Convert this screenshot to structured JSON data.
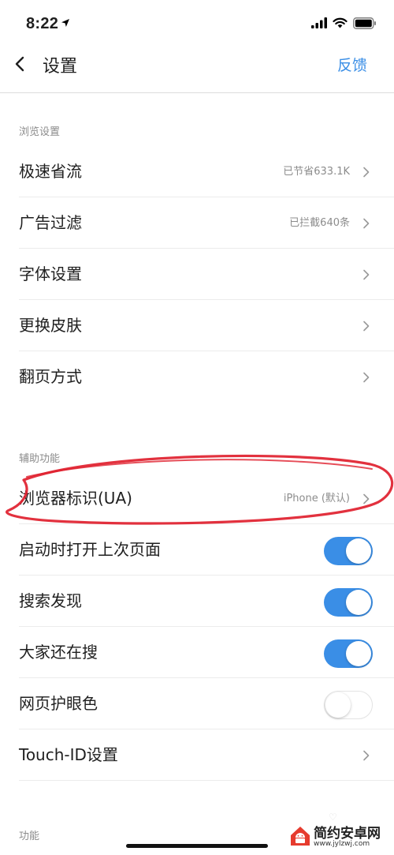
{
  "status_bar": {
    "time": "8:22"
  },
  "nav": {
    "title": "设置",
    "action": "反馈"
  },
  "sections": {
    "browse": "浏览设置",
    "assist": "辅助功能",
    "features": "功能"
  },
  "browse_rows": [
    {
      "label": "极速省流",
      "value": "已节省633.1K"
    },
    {
      "label": "广告过滤",
      "value": "已拦截640条"
    },
    {
      "label": "字体设置"
    },
    {
      "label": "更换皮肤"
    },
    {
      "label": "翻页方式"
    }
  ],
  "assist_rows": [
    {
      "label": "浏览器标识(UA)",
      "value": "iPhone (默认)"
    },
    {
      "label": "启动时打开上次页面",
      "toggle": true
    },
    {
      "label": "搜索发现",
      "toggle": true
    },
    {
      "label": "大家还在搜",
      "toggle": true
    },
    {
      "label": "网页护眼色",
      "toggle": false
    },
    {
      "label": "Touch-ID设置"
    }
  ],
  "watermark": {
    "name": "简约安卓网",
    "url": "www.jylzwj.com"
  },
  "colors": {
    "accent": "#3a8ee6",
    "annotation": "#e0202e"
  }
}
